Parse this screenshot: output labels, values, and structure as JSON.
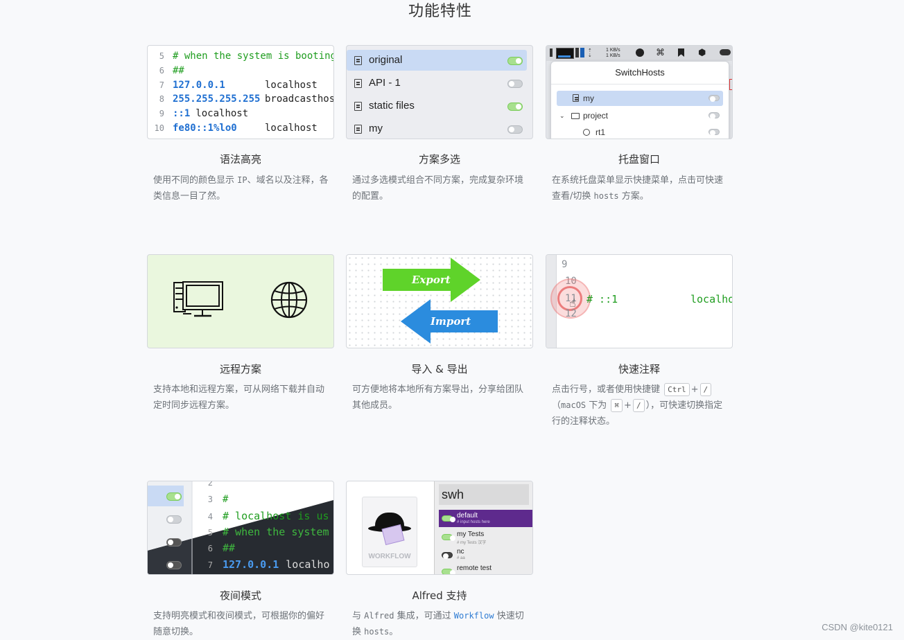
{
  "page_title": "功能特性",
  "features": [
    {
      "title": "语法高亮",
      "desc": "使用不同的颜色显示 IP、域名以及注释，各类信息一目了然。",
      "desc_parts": {
        "a": "使用不同的颜色显示 ",
        "b": "IP",
        "c": "、域名以及注释，各类信息一目了然。"
      }
    },
    {
      "title": "方案多选",
      "desc": "通过多选模式组合不同方案，完成复杂环境的配置。"
    },
    {
      "title": "托盘窗口",
      "desc_parts": {
        "a": "在系统托盘菜单显示快捷菜单，点击可快速查看/切换 ",
        "b": "hosts",
        "c": " 方案。"
      }
    },
    {
      "title": "远程方案",
      "desc": "支持本地和远程方案，可从网络下载并自动定时同步远程方案。"
    },
    {
      "title": "导入 & 导出",
      "desc": "可方便地将本地所有方案导出，分享给团队其他成员。"
    },
    {
      "title": "快速注释",
      "desc_parts": {
        "a": "点击行号，或者使用快捷键 ",
        "k1": "Ctrl",
        "plus": "+",
        "k2": "/",
        "b": "（",
        "c": "macOS",
        "d": " 下为 ",
        "k3": "⌘",
        "k4": "/",
        "e": "），可快速切换指定行的注释状态。"
      }
    },
    {
      "title": "夜间模式",
      "desc": "支持明亮模式和夜间模式，可根据你的偏好随意切换。"
    },
    {
      "title": "Alfred 支持",
      "desc_parts": {
        "a": "与 ",
        "b": "Alfred",
        "c": " 集成，可通过 ",
        "link": "Workflow",
        "d": " 快速切换 ",
        "e": "hosts",
        "f": "。"
      }
    }
  ],
  "syntax_thumb": {
    "lines": [
      {
        "n": "5",
        "a": "# when the system is booting",
        "cls": "c-green",
        "b": ""
      },
      {
        "n": "6",
        "a": "##",
        "cls": "c-green",
        "b": ""
      },
      {
        "n": "7",
        "a": "127.0.0.1",
        "cls": "c-blue",
        "b": "localhost"
      },
      {
        "n": "8",
        "a": "255.255.255.255",
        "cls": "c-blue",
        "b": "broadcasthost"
      },
      {
        "n": "9",
        "a": "::1",
        "cls": "c-blue",
        "b": "localhost"
      },
      {
        "n": "10",
        "a": "fe80::1%lo0",
        "cls": "c-blue",
        "b": "localhost"
      }
    ]
  },
  "multi_thumb": {
    "items": [
      {
        "label": "original",
        "on": true,
        "selected": true
      },
      {
        "label": "API - 1",
        "on": false,
        "selected": false
      },
      {
        "label": "static files",
        "on": true,
        "selected": false
      },
      {
        "label": "my",
        "on": false,
        "selected": false
      }
    ]
  },
  "tray_thumb": {
    "net_up": "1 KB/s",
    "net_down": "1 KB/s",
    "window_title": "SwitchHosts",
    "items": [
      {
        "label": "my"
      },
      {
        "label": "project"
      },
      {
        "label": "rt1"
      }
    ]
  },
  "io_thumb": {
    "export": "Export",
    "import": "Import"
  },
  "comment_thumb": {
    "lines": [
      "9",
      "10",
      "11",
      "12"
    ],
    "code": "# ::1",
    "host": "localho"
  },
  "dark_thumb": {
    "lines": [
      {
        "n": "2",
        "t": ""
      },
      {
        "n": "3",
        "t": "#"
      },
      {
        "n": "4",
        "t": "# localhost is us"
      },
      {
        "n": "5",
        "t": "# when the system"
      },
      {
        "n": "6",
        "t": "##"
      },
      {
        "n": "7",
        "t": "127.0.0.1",
        "h": "localho"
      }
    ]
  },
  "alfred_thumb": {
    "workflow_label": "WORKFLOW",
    "query": "swh",
    "items": [
      {
        "title": "default",
        "sub": "# input hosts here",
        "active": true
      },
      {
        "title": "my Tests",
        "sub": "# my Tests 汉字",
        "active": false
      },
      {
        "title": "nc",
        "sub": "# aa",
        "active": false
      },
      {
        "title": "remote test",
        "sub": "",
        "active": false
      }
    ]
  },
  "watermark": "CSDN @kite0121"
}
